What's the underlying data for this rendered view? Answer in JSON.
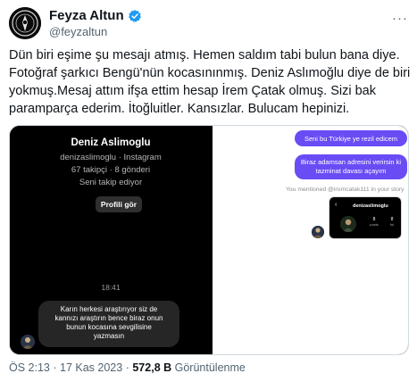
{
  "author": {
    "name": "Feyza Altun",
    "handle": "@feyzaltun",
    "verified_icon": "verified-badge-icon",
    "more_label": "···"
  },
  "tweet": {
    "lines": [
      "Dün biri eşime şu mesajı atmış. Hemen saldım tabi bulun bana diye.",
      "Fotoğraf şarkıcı Bengü'nün kocasınınmış. Deniz Aslımoğlu diye de biri",
      "yokmuş.Mesaj attım ifşa ettim hesap İrem Çatak olmuş. Sizi bak",
      "paramparça ederim. İtoğluitler. Kansızlar. Bulucam hepinizi."
    ]
  },
  "media": {
    "left": {
      "profile_name": "Deniz Aslimoglu",
      "profile_sub": "denizaslimoglu · Instagram",
      "stats": "67 takipçi · 8 gönderi",
      "follow_status": "Seni takip ediyor",
      "view_profile_button": "Profili gör",
      "time": "18:41",
      "message_lines": [
        "Karın herkesi araştırıyor siz de",
        "kannızı araştırın bence biraz onun",
        "bunun kocasına sevgilisine",
        "yazmasın"
      ]
    },
    "right": {
      "bubble1": "Seni bu Türkiye ye rezil edicem",
      "bubble2_lines": [
        "Biraz adamsan adresini verirsin ki",
        "tazminat davası açayım"
      ],
      "mention_text": "You mentioned @iromcatak111 in your story",
      "story_name": "denizaslimoglu",
      "story_back": "‹",
      "story_stats": [
        {
          "value": "8",
          "label": "posts"
        },
        {
          "value": "8",
          "label": "fol"
        }
      ]
    }
  },
  "meta": {
    "time": "ÖS 2:13",
    "separator": "·",
    "date": "17 Kas 2023",
    "views_count": "572,8 B",
    "views_label": "Görüntülenme"
  },
  "colors": {
    "accent_blue": "#1d9bf0",
    "dm_bubble": "#6a4cf5",
    "text_primary": "#0f1419",
    "text_secondary": "#536471"
  }
}
